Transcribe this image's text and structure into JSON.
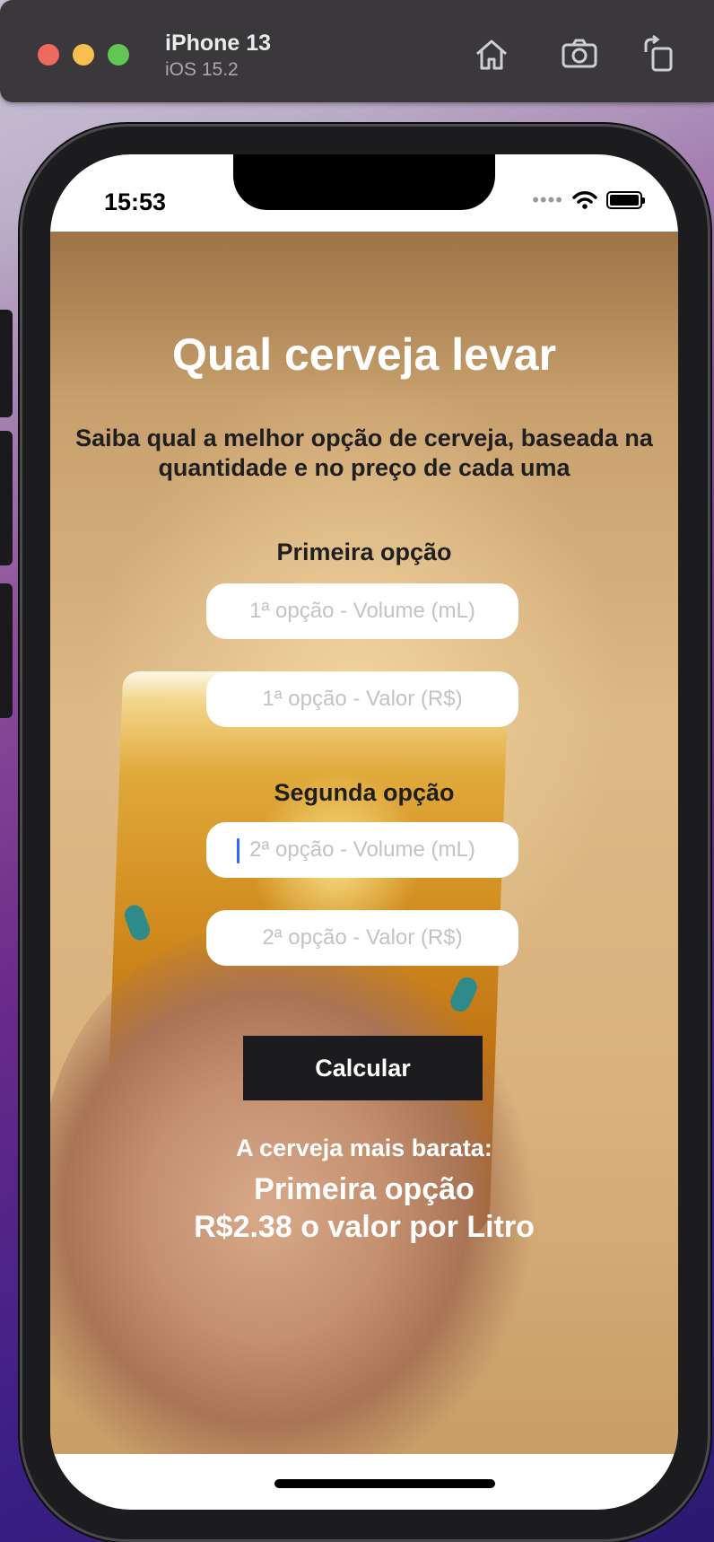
{
  "simulator": {
    "device_name": "iPhone 13",
    "os_version": "iOS 15.2",
    "buttons": {
      "home": "home-icon",
      "screenshot": "camera-icon",
      "rotate": "rotate-icon"
    }
  },
  "status_bar": {
    "time": "15:53",
    "signal_dots": "••••"
  },
  "app": {
    "title": "Qual cerveja levar",
    "subtitle": "Saiba qual a melhor opção de cerveja, baseada na quantidade e no preço de cada uma",
    "first_option": {
      "label": "Primeira opção",
      "volume_placeholder": "1ª opção - Volume (mL)",
      "price_placeholder": "1ª opção - Valor (R$)"
    },
    "second_option": {
      "label": "Segunda opção",
      "volume_placeholder": "2ª opção - Volume (mL)",
      "price_placeholder": "2ª opção - Valor (R$)"
    },
    "calculate_button": "Calcular",
    "result": {
      "label": "A cerveja mais barata:",
      "choice": "Primeira opção",
      "price_per_liter": "R$2.38 o valor por Litro"
    }
  },
  "colors": {
    "button_bg": "#1c1c1e",
    "title_text": "#ffffff",
    "body_text": "#1f1f1f",
    "caret": "#3366ff"
  }
}
